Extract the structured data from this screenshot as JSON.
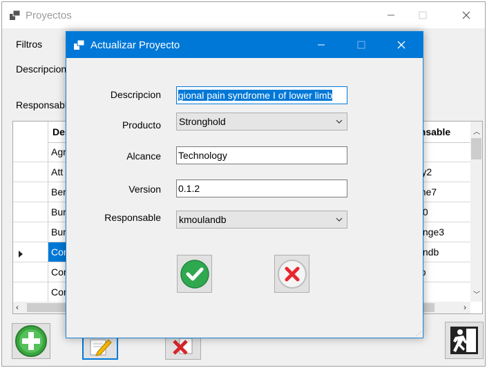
{
  "main": {
    "title": "Proyectos",
    "filters_label": "Filtros",
    "descripcion_label": "Descripcion",
    "responsable_label": "Responsable",
    "grid": {
      "header_descripcion": "Descripcion",
      "header_responsable": "Responsable",
      "rows": [
        {
          "desc": "Agr",
          "resp": ""
        },
        {
          "desc": "Att",
          "resp": "rry2"
        },
        {
          "desc": "Ber",
          "resp": "one7"
        },
        {
          "desc": "Bur",
          "resp": "le0"
        },
        {
          "desc": "Bur",
          "resp": "dinge3"
        },
        {
          "desc": "Cor",
          "resp": "landb"
        },
        {
          "desc": "Cor",
          "resp": "do"
        },
        {
          "desc": "Cor",
          "resp": ""
        }
      ],
      "selected_row": 5
    },
    "buttons": {
      "add_icon": "add-icon",
      "edit_icon": "edit-icon",
      "delete_icon": "delete-icon",
      "exit_icon": "exit-icon"
    }
  },
  "dialog": {
    "title": "Actualizar Proyecto",
    "fields": {
      "descripcion_label": "Descripcion",
      "descripcion_value": "gional pain syndrome I of lower limb",
      "producto_label": "Producto",
      "producto_value": "Stronghold",
      "alcance_label": "Alcance",
      "alcance_value": "Technology",
      "version_label": "Version",
      "version_value": "0.1.2",
      "responsable_label": "Responsable",
      "responsable_value": "kmoulandb"
    },
    "ok_icon": "check-icon",
    "cancel_icon": "cancel-icon"
  },
  "colors": {
    "accent": "#0078d7",
    "ok_green": "#2fa84f",
    "cancel_red": "#e8262c"
  }
}
